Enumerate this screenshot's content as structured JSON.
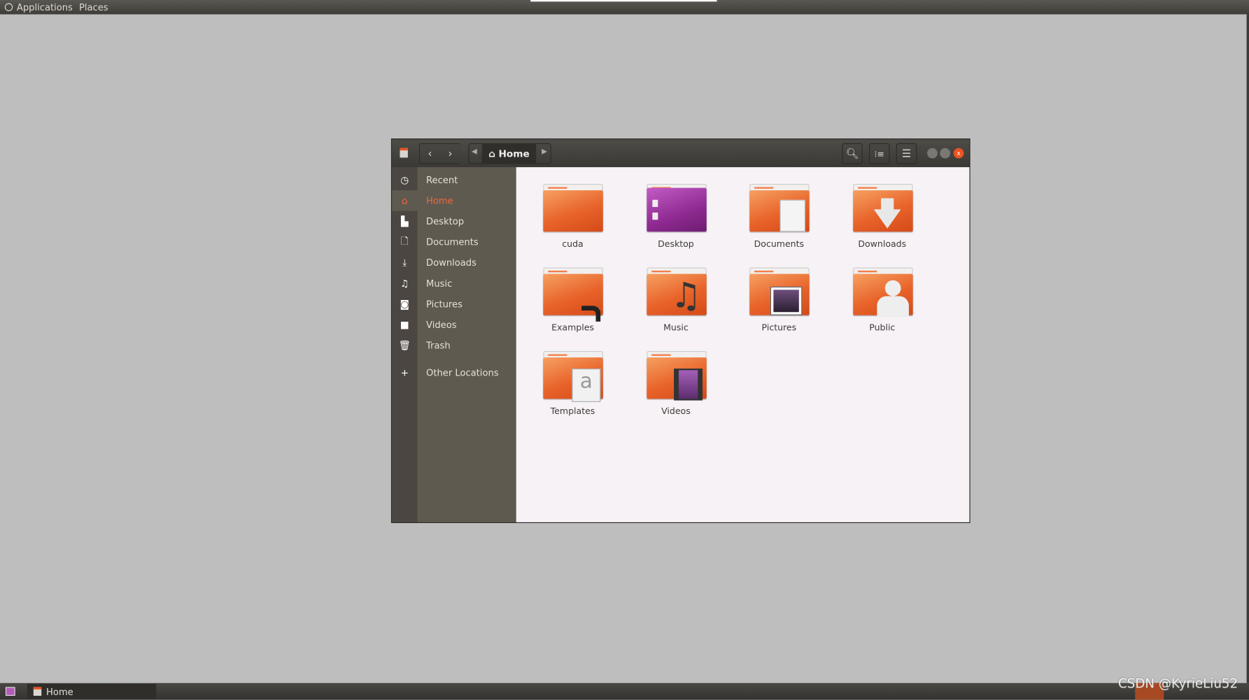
{
  "topbar": {
    "menus": [
      {
        "label": "Applications"
      },
      {
        "label": "Places"
      }
    ]
  },
  "window": {
    "path": {
      "current": "Home",
      "icon": "home-icon"
    },
    "toolbar": {
      "search": "search-icon",
      "view": "list-view-icon",
      "menu": "hamburger-menu-icon"
    },
    "sidebar": {
      "items": [
        {
          "label": "Recent",
          "icon": "clock-icon"
        },
        {
          "label": "Home",
          "icon": "home-icon",
          "active": true
        },
        {
          "label": "Desktop",
          "icon": "folder-icon"
        },
        {
          "label": "Documents",
          "icon": "document-icon"
        },
        {
          "label": "Downloads",
          "icon": "download-icon"
        },
        {
          "label": "Music",
          "icon": "music-icon"
        },
        {
          "label": "Pictures",
          "icon": "camera-icon"
        },
        {
          "label": "Videos",
          "icon": "video-icon"
        },
        {
          "label": "Trash",
          "icon": "trash-icon"
        },
        {
          "label": "Other Locations",
          "icon": "plus-icon"
        }
      ]
    },
    "files": [
      {
        "name": "cuda",
        "icon": "folder-icon"
      },
      {
        "name": "Desktop",
        "icon": "desktop-folder-icon"
      },
      {
        "name": "Documents",
        "icon": "documents-folder-icon"
      },
      {
        "name": "Downloads",
        "icon": "downloads-folder-icon"
      },
      {
        "name": "Examples",
        "icon": "examples-folder-icon"
      },
      {
        "name": "Music",
        "icon": "music-folder-icon"
      },
      {
        "name": "Pictures",
        "icon": "pictures-folder-icon"
      },
      {
        "name": "Public",
        "icon": "public-folder-icon"
      },
      {
        "name": "Templates",
        "icon": "templates-folder-icon"
      },
      {
        "name": "Videos",
        "icon": "videos-folder-icon"
      }
    ]
  },
  "taskbar": {
    "window_label": "Home"
  },
  "watermark": "CSDN @KyrieLiu52",
  "colors": {
    "accent": "#e95420",
    "content_bg": "#f7f2f6",
    "sidebar_bg": "#5f5a50"
  }
}
